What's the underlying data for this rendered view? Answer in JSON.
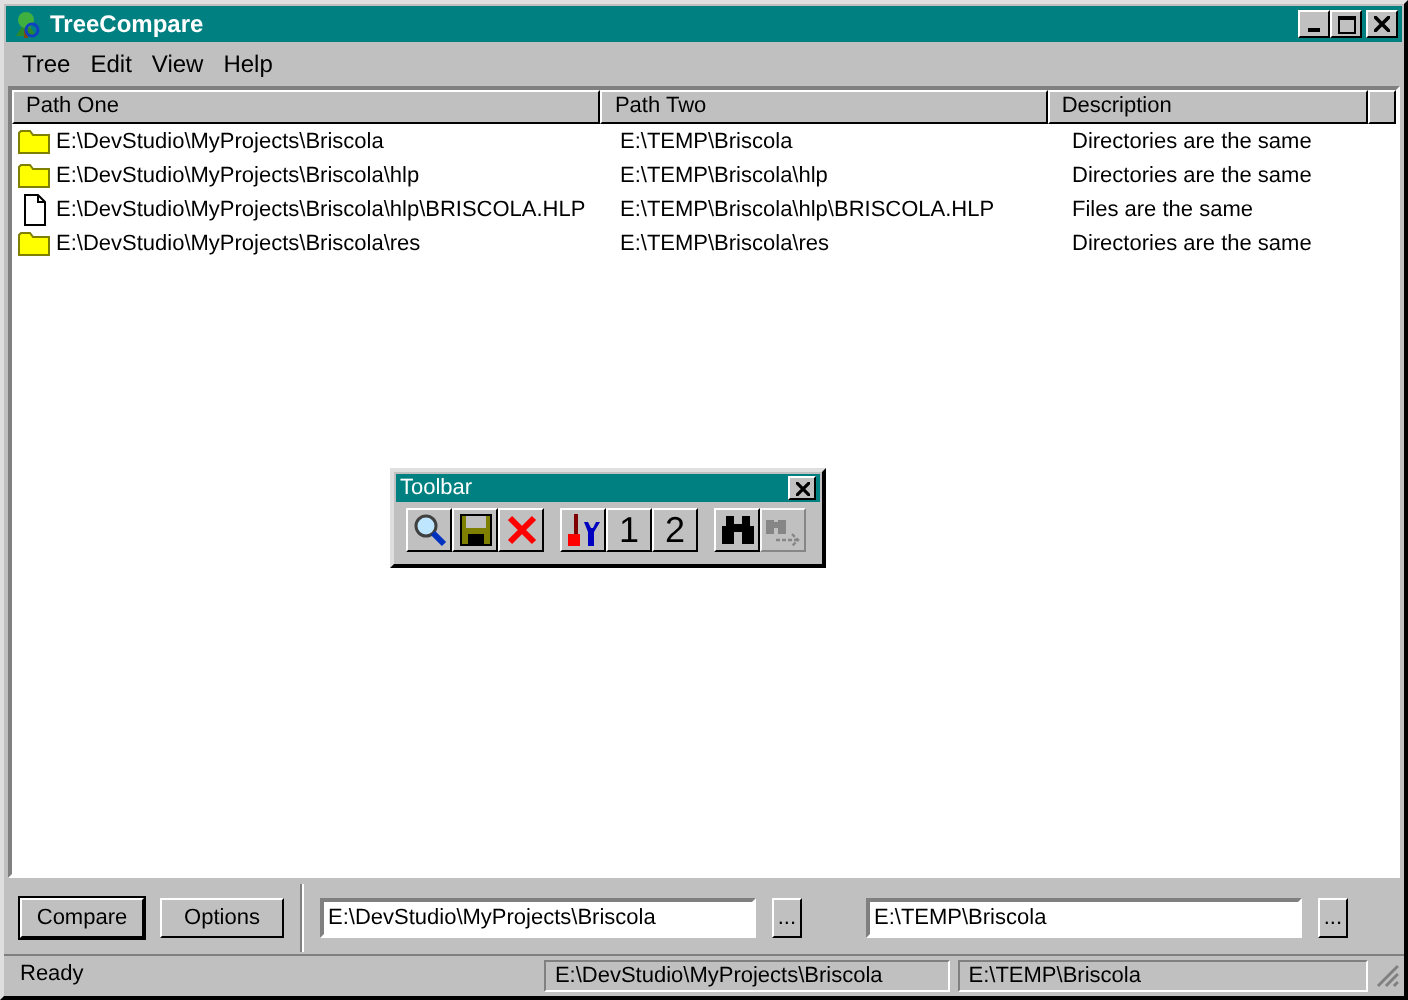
{
  "window": {
    "title": "TreeCompare"
  },
  "menu": [
    "Tree",
    "Edit",
    "View",
    "Help"
  ],
  "table": {
    "columns": [
      "Path One",
      "Path Two",
      "Description"
    ],
    "rows": [
      {
        "kind": "folder",
        "cells": [
          "E:\\DevStudio\\MyProjects\\Briscola",
          "E:\\TEMP\\Briscola",
          "Directories are the same"
        ]
      },
      {
        "kind": "folder",
        "cells": [
          "E:\\DevStudio\\MyProjects\\Briscola\\hlp",
          "E:\\TEMP\\Briscola\\hlp",
          "Directories are the same"
        ]
      },
      {
        "kind": "file",
        "cells": [
          "E:\\DevStudio\\MyProjects\\Briscola\\hlp\\BRISCOLA.HLP",
          "E:\\TEMP\\Briscola\\hlp\\BRISCOLA.HLP",
          "Files are the same"
        ]
      },
      {
        "kind": "folder",
        "cells": [
          "E:\\DevStudio\\MyProjects\\Briscola\\res",
          "E:\\TEMP\\Briscola\\res",
          "Directories are the same"
        ]
      }
    ]
  },
  "toolbar": {
    "title": "Toolbar",
    "buttons": [
      {
        "kind": "search",
        "disabled": false
      },
      {
        "kind": "save",
        "disabled": false
      },
      {
        "kind": "delete",
        "disabled": false
      },
      {
        "kind": "tools",
        "disabled": false
      },
      {
        "kind": "text",
        "label": "1",
        "disabled": false
      },
      {
        "kind": "text",
        "label": "2",
        "disabled": false
      },
      {
        "kind": "find",
        "disabled": false
      },
      {
        "kind": "find-next",
        "disabled": true
      }
    ]
  },
  "bottom": {
    "buttons": [
      "Compare",
      "Options"
    ],
    "path_one": "E:\\DevStudio\\MyProjects\\Briscola",
    "path_two": "E:\\TEMP\\Briscola",
    "browse": [
      "...",
      "..."
    ]
  },
  "status_bar": [
    "Ready",
    "E:\\DevStudio\\MyProjects\\Briscola",
    "E:\\TEMP\\Briscola"
  ]
}
